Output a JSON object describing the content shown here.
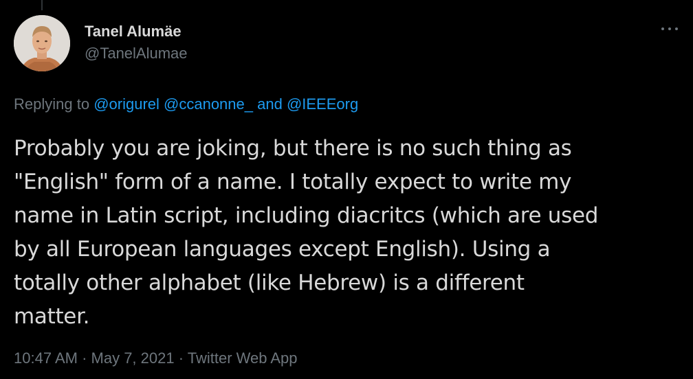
{
  "tweet": {
    "author": {
      "display_name": "Tanel Alumäe",
      "handle": "@TanelAlumae",
      "avatar_icon": "user-avatar-photo"
    },
    "more_icon": "more-horizontal-icon",
    "replying": {
      "prefix": "Replying to ",
      "mentions": [
        "@origurel",
        "@ccanonne_"
      ],
      "conjunction": " and ",
      "last_mention": "@IEEEorg"
    },
    "text": "Probably you are joking, but there is no such thing as\n\"English\" form of a name. I totally expect to write my\nname in Latin script, including diacritcs (which are used\nby all European languages except English). Using a\ntotally other alphabet (like Hebrew) is a different\nmatter.",
    "time": "10:47 AM",
    "date": "May 7, 2021",
    "separator": " · ",
    "source": "Twitter Web App"
  },
  "colors": {
    "background": "#000000",
    "text_primary": "#d9d9d9",
    "text_secondary": "#6e767d",
    "accent": "#1d9bf0",
    "thread_line": "#2f3336"
  }
}
